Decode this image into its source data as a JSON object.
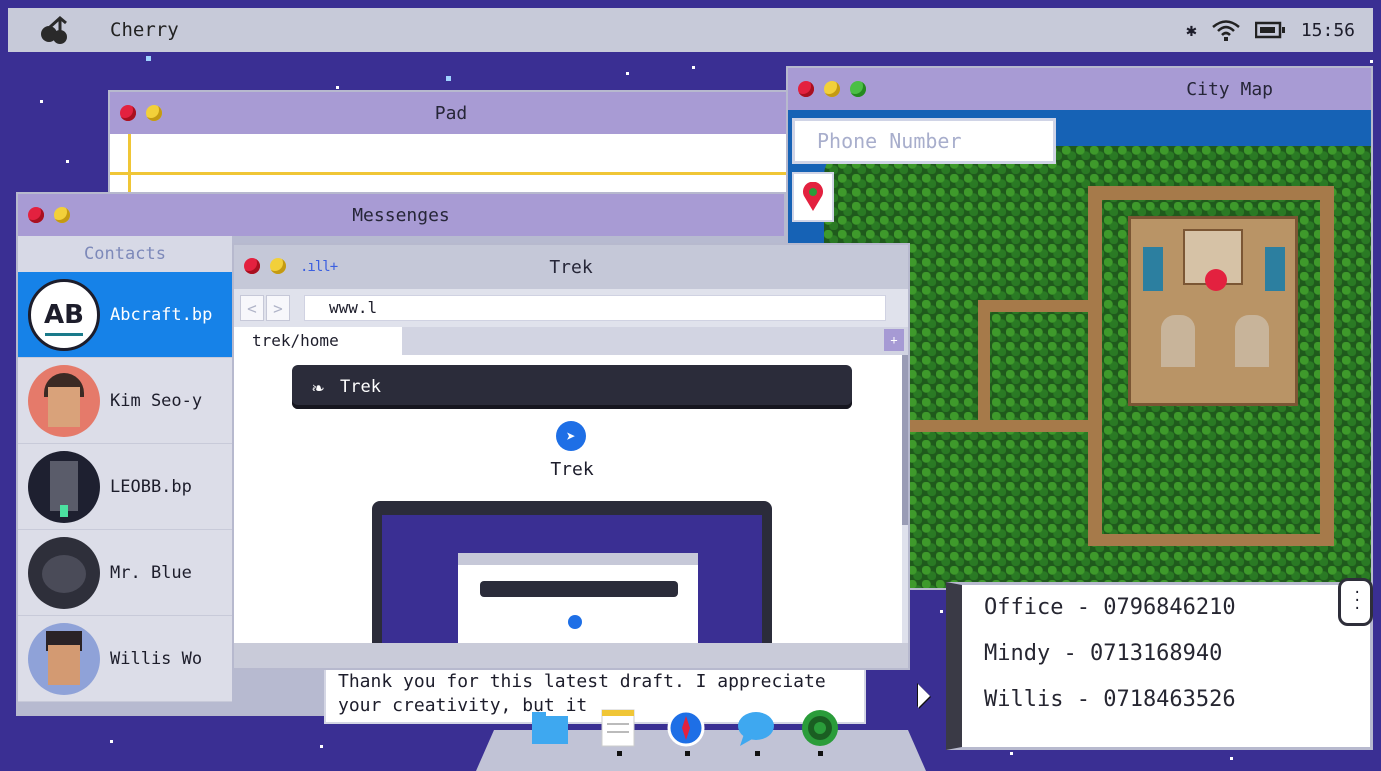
{
  "menubar": {
    "app_name": "Cherry",
    "status_icons": [
      "bluetooth-icon",
      "wifi-icon",
      "battery-icon"
    ],
    "clock": "15:56"
  },
  "pad": {
    "title": "Pad"
  },
  "city_map": {
    "title": "City Map",
    "phone_placeholder": "Phone Number",
    "pin_icon": "map-pin-icon"
  },
  "phone_list": {
    "entries": [
      "Office - 0796846210",
      "Mindy - 0713168940",
      "Willis - 0718463526"
    ]
  },
  "messenges": {
    "title": "Messenges",
    "contacts_header": "Contacts",
    "contacts": [
      {
        "name": "Abcraft.bp",
        "avatar_text": "AB",
        "selected": true
      },
      {
        "name": "Kim Seo-y",
        "selected": false
      },
      {
        "name": "LEOBB.bp",
        "selected": false
      },
      {
        "name": "Mr. Blue",
        "selected": false
      },
      {
        "name": "Willis Wo",
        "selected": false
      }
    ],
    "message_text": "Thank you for this latest draft. I appreciate your creativity, but it"
  },
  "trek": {
    "title": "Trek",
    "url": "www.l",
    "tab_label": "trek/home",
    "tab_add": "+",
    "back": "<",
    "forward": ">",
    "signal": ".ıll+",
    "searchbar_text": "Trek",
    "page_label": "Trek"
  },
  "dock": {
    "items": [
      "folder-icon",
      "notes-icon",
      "compass-icon",
      "chat-bubble-icon",
      "target-icon"
    ]
  },
  "colors": {
    "desktop": "#3a2f93",
    "titlebar": "#a89bd4",
    "selected": "#1682e8",
    "menubar": "#c7cad9"
  }
}
